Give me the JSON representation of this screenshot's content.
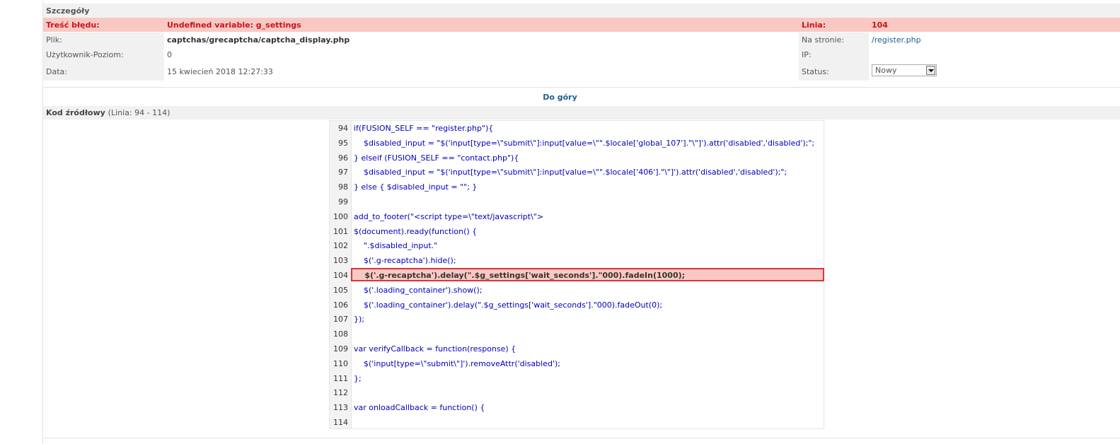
{
  "details": {
    "title": "Szczegóły",
    "error_label": "Treść błędu:",
    "error_value": "Undefined variable: g_settings",
    "line_label": "Linia:",
    "line_value": "104",
    "file_label": "Plik:",
    "file_value": "captchas/grecaptcha/captcha_display.php",
    "page_label": "Na stronie:",
    "page_value": "/register.php",
    "user_label": "Użytkownik-Poziom:",
    "user_value": "0",
    "ip_label": "IP:",
    "ip_value": "",
    "date_label": "Data:",
    "date_value": "15 kwiecień 2018 12:27:33",
    "status_label": "Status:",
    "status_value": "Nowy"
  },
  "top_link": "Do góry",
  "source": {
    "title": "Kod źródłowy",
    "range": "(Linia: 94 - 114)",
    "highlight_line": 104,
    "lines": [
      {
        "n": "94",
        "text": "if(FUSION_SELF == \"register.php\"){"
      },
      {
        "n": "95",
        "text": "    $disabled_input = \"$('input[type=\\\"submit\\\"]:input[value=\\\"\".$locale['global_107'].\"\\\"]').attr('disabled','disabled');\";"
      },
      {
        "n": "96",
        "text": "} elseif (FUSION_SELF == \"contact.php\"){"
      },
      {
        "n": "97",
        "text": "    $disabled_input = \"$('input[type=\\\"submit\\\"]:input[value=\\\"\".$locale['406'].\"\\\"]').attr('disabled','disabled');\";"
      },
      {
        "n": "98",
        "text": "} else { $disabled_input = \"\"; }"
      },
      {
        "n": "99",
        "text": ""
      },
      {
        "n": "100",
        "text": "add_to_footer(\"<script type=\\\"text/javascript\\\">"
      },
      {
        "n": "101",
        "text": "$(document).ready(function() {"
      },
      {
        "n": "102",
        "text": "    \".$disabled_input.\""
      },
      {
        "n": "103",
        "text": "    $('.g-recaptcha').hide();"
      },
      {
        "n": "104",
        "text": "    $('.g-recaptcha').delay(\".$g_settings['wait_seconds'].\"000).fadeIn(1000);"
      },
      {
        "n": "105",
        "text": "    $('.loading_container').show();"
      },
      {
        "n": "106",
        "text": "    $('.loading_container').delay(\".$g_settings['wait_seconds'].\"000).fadeOut(0);"
      },
      {
        "n": "107",
        "text": "});"
      },
      {
        "n": "108",
        "text": ""
      },
      {
        "n": "109",
        "text": "var verifyCallback = function(response) {"
      },
      {
        "n": "110",
        "text": "    $('input[type=\\\"submit\\\"]').removeAttr('disabled');"
      },
      {
        "n": "111",
        "text": "};"
      },
      {
        "n": "112",
        "text": ""
      },
      {
        "n": "113",
        "text": "var onloadCallback = function() {"
      },
      {
        "n": "114",
        "text": ""
      }
    ]
  }
}
